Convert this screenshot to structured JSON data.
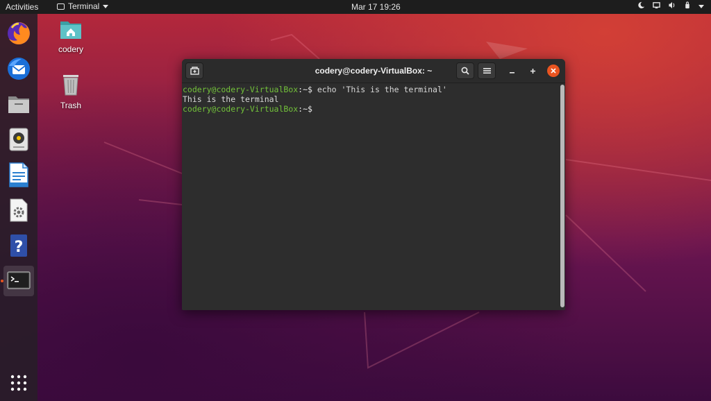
{
  "topbar": {
    "activities": "Activities",
    "app_name": "Terminal",
    "clock": "Mar 17  19:26"
  },
  "dock": {
    "items": [
      "firefox",
      "thunderbird",
      "files",
      "rhythmbox",
      "libreoffice-writer",
      "software-updater",
      "help",
      "terminal"
    ],
    "show_apps": "show-applications"
  },
  "desktop": {
    "icons": [
      {
        "label": "codery"
      },
      {
        "label": "Trash"
      }
    ]
  },
  "terminal": {
    "title": "codery@codery-VirtualBox: ~",
    "lines": [
      {
        "user": "codery@codery-VirtualBox",
        "path": ":~$",
        "cmd": " echo 'This is the terminal'"
      },
      {
        "output": "This is the terminal"
      },
      {
        "user": "codery@codery-VirtualBox",
        "path": ":~$",
        "cmd": ""
      }
    ]
  },
  "colors": {
    "accent": "#e95420",
    "prompt_green": "#73c23a",
    "terminal_bg": "#2d2d2d",
    "topbar_bg": "#1d1d1d"
  }
}
